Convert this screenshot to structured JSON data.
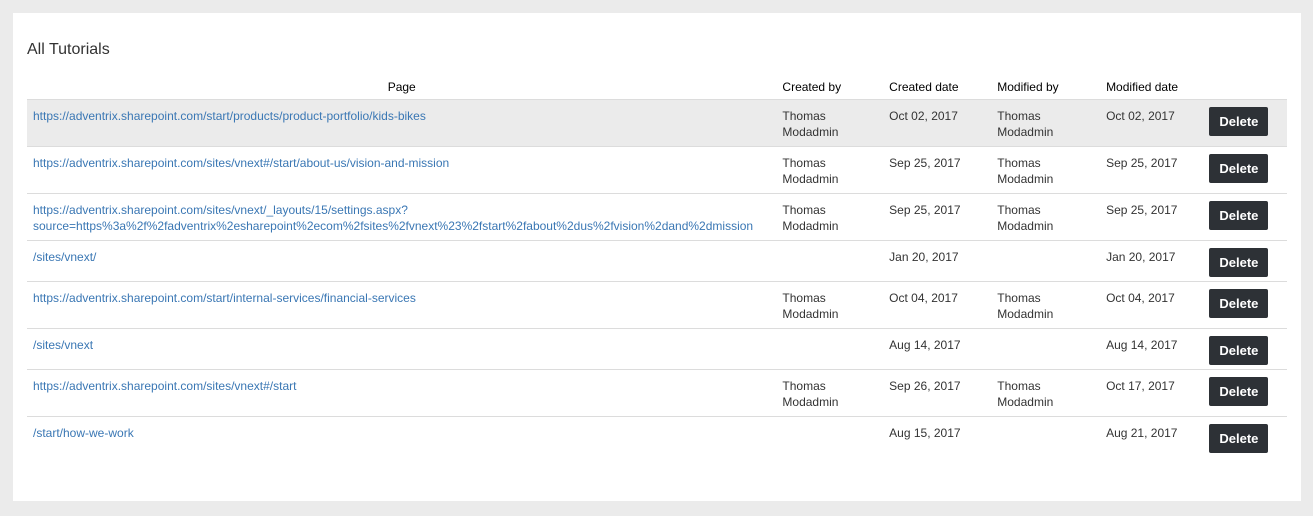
{
  "title": "All Tutorials",
  "columns": {
    "page": "Page",
    "created_by": "Created by",
    "created_date": "Created date",
    "modified_by": "Modified by",
    "modified_date": "Modified date"
  },
  "delete_label": "Delete",
  "colors": {
    "link": "#3a77b4",
    "button_bg": "#2d3136",
    "highlight_row": "#ebebeb"
  },
  "rows": [
    {
      "page": "https://adventrix.sharepoint.com/start/products/product-portfolio/kids-bikes",
      "created_by": "Thomas Modadmin",
      "created_date": "Oct 02, 2017",
      "modified_by": "Thomas Modadmin",
      "modified_date": "Oct 02, 2017"
    },
    {
      "page": "https://adventrix.sharepoint.com/sites/vnext#/start/about-us/vision-and-mission",
      "created_by": "Thomas Modadmin",
      "created_date": "Sep 25, 2017",
      "modified_by": "Thomas Modadmin",
      "modified_date": "Sep 25, 2017"
    },
    {
      "page": "https://adventrix.sharepoint.com/sites/vnext/_layouts/15/settings.aspx?source=https%3a%2f%2fadventrix%2esharepoint%2ecom%2fsites%2fvnext%23%2fstart%2fabout%2dus%2fvision%2dand%2dmission",
      "page_line1": "https://adventrix.sharepoint.com/sites/vnext/_layouts/15/settings.aspx?",
      "page_line2": "source=https%3a%2f%2fadventrix%2esharepoint%2ecom%2fsites%2fvnext%23%2fstart%2fabout%2dus%2fvision%2dand%2dmission",
      "created_by": "Thomas Modadmin",
      "created_date": "Sep 25, 2017",
      "modified_by": "Thomas Modadmin",
      "modified_date": "Sep 25, 2017"
    },
    {
      "page": "/sites/vnext/",
      "created_by": "",
      "created_date": "Jan 20, 2017",
      "modified_by": "",
      "modified_date": "Jan 20, 2017"
    },
    {
      "page": "https://adventrix.sharepoint.com/start/internal-services/financial-services",
      "created_by": "Thomas Modadmin",
      "created_date": "Oct 04, 2017",
      "modified_by": "Thomas Modadmin",
      "modified_date": "Oct 04, 2017"
    },
    {
      "page": "/sites/vnext",
      "created_by": "",
      "created_date": "Aug 14, 2017",
      "modified_by": "",
      "modified_date": "Aug 14, 2017"
    },
    {
      "page": "https://adventrix.sharepoint.com/sites/vnext#/start",
      "created_by": "Thomas Modadmin",
      "created_date": "Sep 26, 2017",
      "modified_by": "Thomas Modadmin",
      "modified_date": "Oct 17, 2017"
    },
    {
      "page": "/start/how-we-work",
      "created_by": "",
      "created_date": "Aug 15, 2017",
      "modified_by": "",
      "modified_date": "Aug 21, 2017"
    }
  ]
}
